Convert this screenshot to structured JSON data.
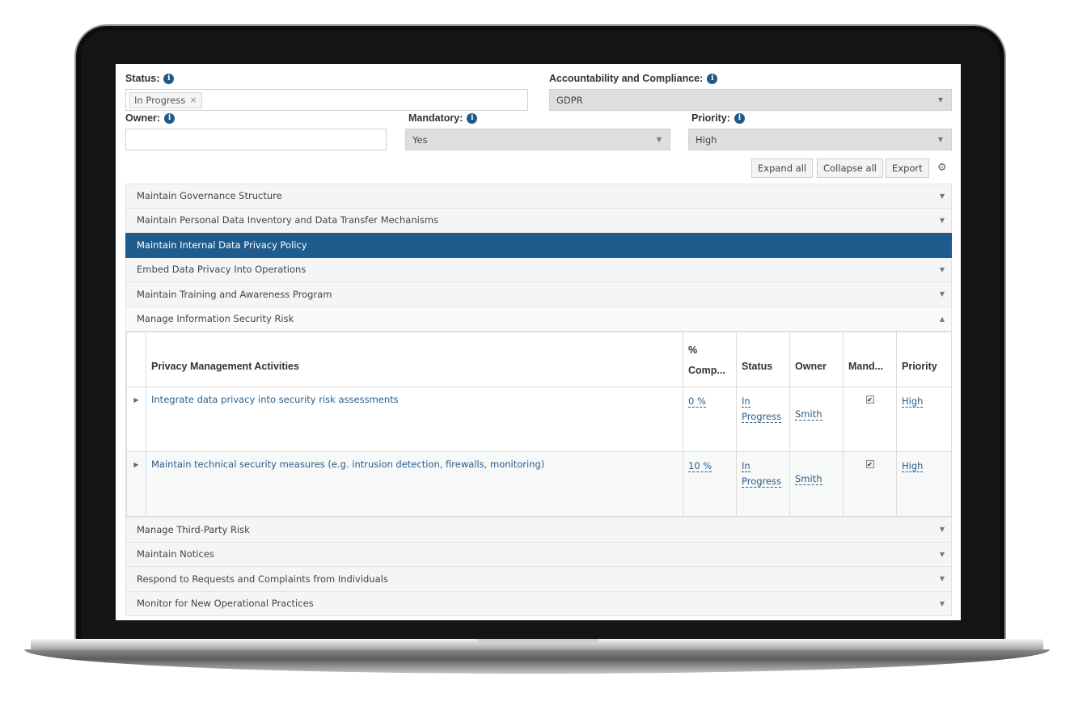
{
  "filters": {
    "status": {
      "label": "Status:",
      "selected_token": "In Progress"
    },
    "accountability": {
      "label": "Accountability and Compliance:",
      "value": "GDPR"
    },
    "owner": {
      "label": "Owner:",
      "value": ""
    },
    "mandatory": {
      "label": "Mandatory:",
      "value": "Yes"
    },
    "priority": {
      "label": "Priority:",
      "value": "High"
    }
  },
  "toolbar": {
    "expand_all": "Expand all",
    "collapse_all": "Collapse all",
    "export": "Export"
  },
  "sections": [
    {
      "title": "Maintain Governance Structure"
    },
    {
      "title": "Maintain Personal Data Inventory and Data Transfer Mechanisms"
    },
    {
      "title": "Maintain Internal Data Privacy Policy"
    },
    {
      "title": "Embed Data Privacy Into Operations"
    },
    {
      "title": "Maintain Training and Awareness Program"
    },
    {
      "title": "Manage Information Security Risk"
    },
    {
      "title": "Manage Third-Party Risk"
    },
    {
      "title": "Maintain Notices"
    },
    {
      "title": "Respond to Requests and Complaints from Individuals"
    },
    {
      "title": "Monitor for New Operational Practices"
    }
  ],
  "activities_table": {
    "columns": {
      "activity": "Privacy Management Activities",
      "completion_line1": "%",
      "completion_line2": "Comp...",
      "status": "Status",
      "owner": "Owner",
      "mandatory": "Mand...",
      "priority": "Priority"
    },
    "rows": [
      {
        "activity": "Integrate data privacy into security risk assessments",
        "completion": "0 %",
        "status_line1": "In",
        "status_line2": "Progress",
        "owner": "Smith",
        "mandatory": true,
        "priority": "High"
      },
      {
        "activity": "Maintain technical security measures (e.g. intrusion detection, firewalls, monitoring)",
        "completion": "10 %",
        "status_line1": "In",
        "status_line2": "Progress",
        "owner": "Smith",
        "mandatory": true,
        "priority": "High"
      }
    ]
  },
  "icons": {
    "info": "info-icon",
    "settings": "gear-icon",
    "collapsed": "caret-down-icon",
    "expanded": "caret-up-icon",
    "row_expander": "caret-right-icon"
  },
  "colors": {
    "active_section": "#1f5c8d",
    "link": "#2a5d8a",
    "info_icon": "#1c5a8c"
  }
}
